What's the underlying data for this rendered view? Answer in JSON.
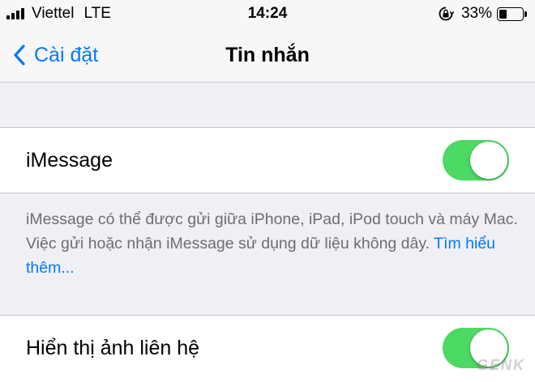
{
  "status_bar": {
    "carrier": "Viettel",
    "network": "LTE",
    "time": "14:24",
    "battery_percent": "33%",
    "battery_level": 0.33,
    "icons": [
      "signal-icon",
      "orientation-lock-icon",
      "battery-icon"
    ]
  },
  "nav": {
    "back_label": "Cài đặt",
    "back_icon": "chevron-left-icon",
    "title": "Tin nhắn"
  },
  "settings": {
    "imessage": {
      "label": "iMessage",
      "enabled": true
    },
    "imessage_footer": {
      "text": "iMessage có thể được gửi giữa iPhone, iPad, iPod touch và máy Mac. Việc gửi hoặc nhận iMessage sử dụng dữ liệu không dây. ",
      "link": "Tìm hiểu thêm..."
    },
    "show_contact_photos": {
      "label": "Hiển thị ảnh liên hệ",
      "enabled": true
    }
  },
  "watermark": "GENK",
  "colors": {
    "accent": "#007aff",
    "toggle_on": "#4cd964",
    "background": "#efeff4",
    "footer_text": "#6d6d72"
  }
}
